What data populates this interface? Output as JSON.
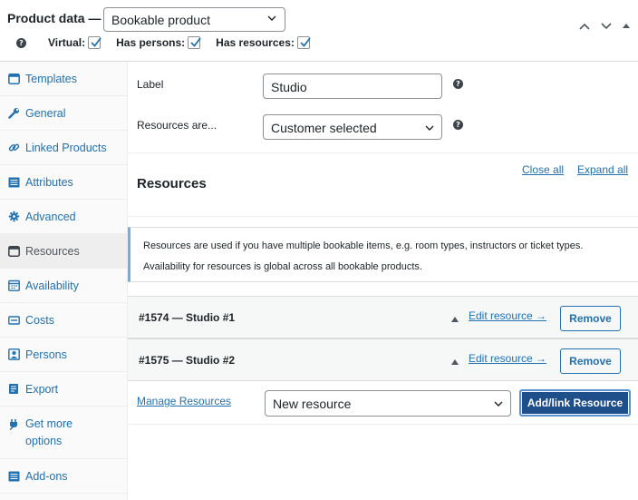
{
  "header": {
    "title": "Product data —",
    "product_type": "Bookable product",
    "options": [
      {
        "label": "Virtual:",
        "checked": true
      },
      {
        "label": "Has persons:",
        "checked": true
      },
      {
        "label": "Has resources:",
        "checked": true
      }
    ],
    "help_glyph": "?"
  },
  "sidebar": {
    "items": [
      {
        "label": "Templates",
        "icon": "window-icon"
      },
      {
        "label": "General",
        "icon": "wrench-icon"
      },
      {
        "label": "Linked Products",
        "icon": "link-icon"
      },
      {
        "label": "Attributes",
        "icon": "list-icon"
      },
      {
        "label": "Advanced",
        "icon": "gear-icon"
      },
      {
        "label": "Resources",
        "icon": "window-icon",
        "active": true
      },
      {
        "label": "Availability",
        "icon": "calendar-icon"
      },
      {
        "label": "Costs",
        "icon": "money-icon"
      },
      {
        "label": "Persons",
        "icon": "person-icon"
      },
      {
        "label": "Export",
        "icon": "export-icon"
      },
      {
        "label": "Get more options",
        "icon": "plugin-icon"
      },
      {
        "label": "Add-ons",
        "icon": "list-icon"
      }
    ]
  },
  "main": {
    "label_field": {
      "label": "Label",
      "value": "Studio"
    },
    "resources_are": {
      "label": "Resources are...",
      "value": "Customer selected"
    },
    "section_title": "Resources",
    "close_all": "Close all",
    "expand_all": "Expand all",
    "notice_line1": "Resources are used if you have multiple bookable items, e.g. room types, instructors or ticket types.",
    "notice_line2": "Availability for resources is global across all bookable products.",
    "resources": [
      {
        "name": "#1574 — Studio #1",
        "edit": "Edit resource →",
        "remove": "Remove"
      },
      {
        "name": "#1575 — Studio #2",
        "edit": "Edit resource →",
        "remove": "Remove"
      }
    ],
    "manage_resources": "Manage Resources",
    "new_resource": "New resource",
    "add_button": "Add/link Resource"
  }
}
